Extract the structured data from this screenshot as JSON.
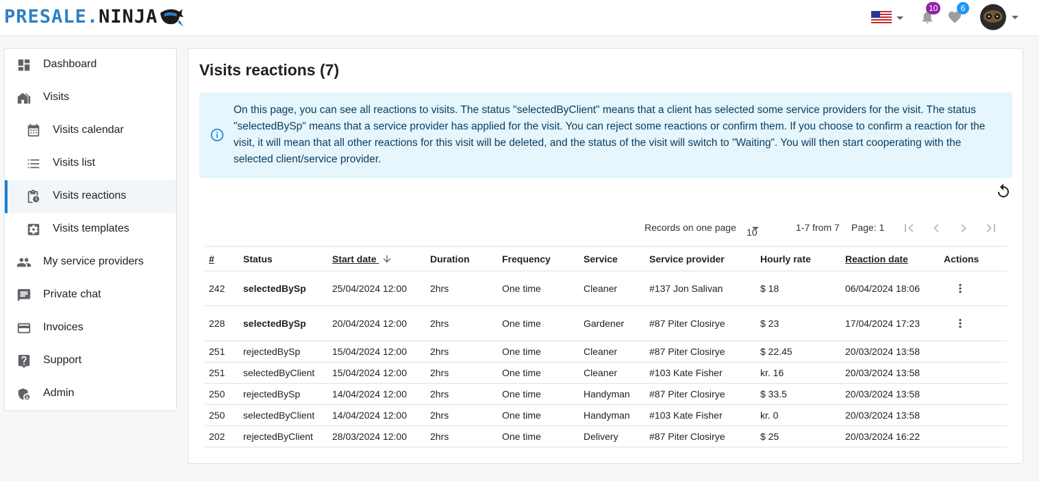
{
  "brand": {
    "part1": "PRESALE.",
    "part2": "NINJA"
  },
  "header": {
    "language_flag": "us-flag-icon",
    "notifications_count": "10",
    "favorites_count": "6",
    "badge_colors": {
      "notifications": "#8e24aa",
      "favorites": "#2196f3"
    }
  },
  "sidebar": {
    "items": [
      {
        "label": "Dashboard",
        "icon": "dashboard-icon"
      },
      {
        "label": "Visits",
        "icon": "house-icon"
      },
      {
        "label": "Visits calendar",
        "icon": "calendar-icon"
      },
      {
        "label": "Visits list",
        "icon": "list-icon"
      },
      {
        "label": "Visits reactions",
        "icon": "clipboard-clock-icon",
        "active": true
      },
      {
        "label": "Visits templates",
        "icon": "gear-box-icon"
      },
      {
        "label": "My service providers",
        "icon": "people-icon"
      },
      {
        "label": "Private chat",
        "icon": "chat-icon"
      },
      {
        "label": "Invoices",
        "icon": "card-icon"
      },
      {
        "label": "Support",
        "icon": "help-icon"
      },
      {
        "label": "Admin",
        "icon": "admin-shield-icon"
      }
    ]
  },
  "main": {
    "title": "Visits reactions (7)",
    "info": "On this page, you can see all reactions to visits. The status \"selectedByClient\" means that a client has selected some service providers for the visit. The status \"selectedBySp\" means that a service provider has applied for the visit. You can reject some reactions or confirm them. If you choose to confirm a reaction for the visit, it will mean that all other reactions for this visit will be deleted, and the status of the visit will switch to \"Waiting\". You will then start cooperating with the selected client/service provider.",
    "pager": {
      "records_label": "Records on one page",
      "per_page": "10",
      "range": "1-7 from 7",
      "page": "Page: 1"
    },
    "table": {
      "headers": {
        "id": "#",
        "status": "Status",
        "start_date": "Start date",
        "duration": "Duration",
        "frequency": "Frequency",
        "service": "Service",
        "provider": "Service provider",
        "rate": "Hourly rate",
        "reaction_date": "Reaction date",
        "actions": "Actions"
      },
      "rows": [
        {
          "id": "242",
          "status": "selectedBySp",
          "start": "25/04/2024 12:00",
          "duration": "2hrs",
          "frequency": "One time",
          "service": "Cleaner",
          "provider": "#137 Jon Salivan",
          "rate": "$ 18",
          "reaction": "06/04/2024 18:06"
        },
        {
          "id": "228",
          "status": "selectedBySp",
          "start": "20/04/2024 12:00",
          "duration": "2hrs",
          "frequency": "One time",
          "service": "Gardener",
          "provider": "#87 Piter Closirye",
          "rate": "$ 23",
          "reaction": "17/04/2024 17:23"
        },
        {
          "id": "251",
          "status": "rejectedBySp",
          "start": "15/04/2024 12:00",
          "duration": "2hrs",
          "frequency": "One time",
          "service": "Cleaner",
          "provider": "#87 Piter Closirye",
          "rate": "$ 22.45",
          "reaction": "20/03/2024 13:58"
        },
        {
          "id": "251",
          "status": "selectedByClient",
          "start": "15/04/2024 12:00",
          "duration": "2hrs",
          "frequency": "One time",
          "service": "Cleaner",
          "provider": "#103 Kate Fisher",
          "rate": "kr. 16",
          "reaction": "20/03/2024 13:58"
        },
        {
          "id": "250",
          "status": "rejectedBySp",
          "start": "14/04/2024 12:00",
          "duration": "2hrs",
          "frequency": "One time",
          "service": "Handyman",
          "provider": "#87 Piter Closirye",
          "rate": "$ 33.5",
          "reaction": "20/03/2024 13:58"
        },
        {
          "id": "250",
          "status": "selectedByClient",
          "start": "14/04/2024 12:00",
          "duration": "2hrs",
          "frequency": "One time",
          "service": "Handyman",
          "provider": "#103 Kate Fisher",
          "rate": "kr. 0",
          "reaction": "20/03/2024 13:58"
        },
        {
          "id": "202",
          "status": "rejectedByClient",
          "start": "28/03/2024 12:00",
          "duration": "2hrs",
          "frequency": "One time",
          "service": "Delivery",
          "provider": "#87 Piter Closirye",
          "rate": "$ 25",
          "reaction": "20/03/2024 16:22"
        }
      ]
    }
  }
}
